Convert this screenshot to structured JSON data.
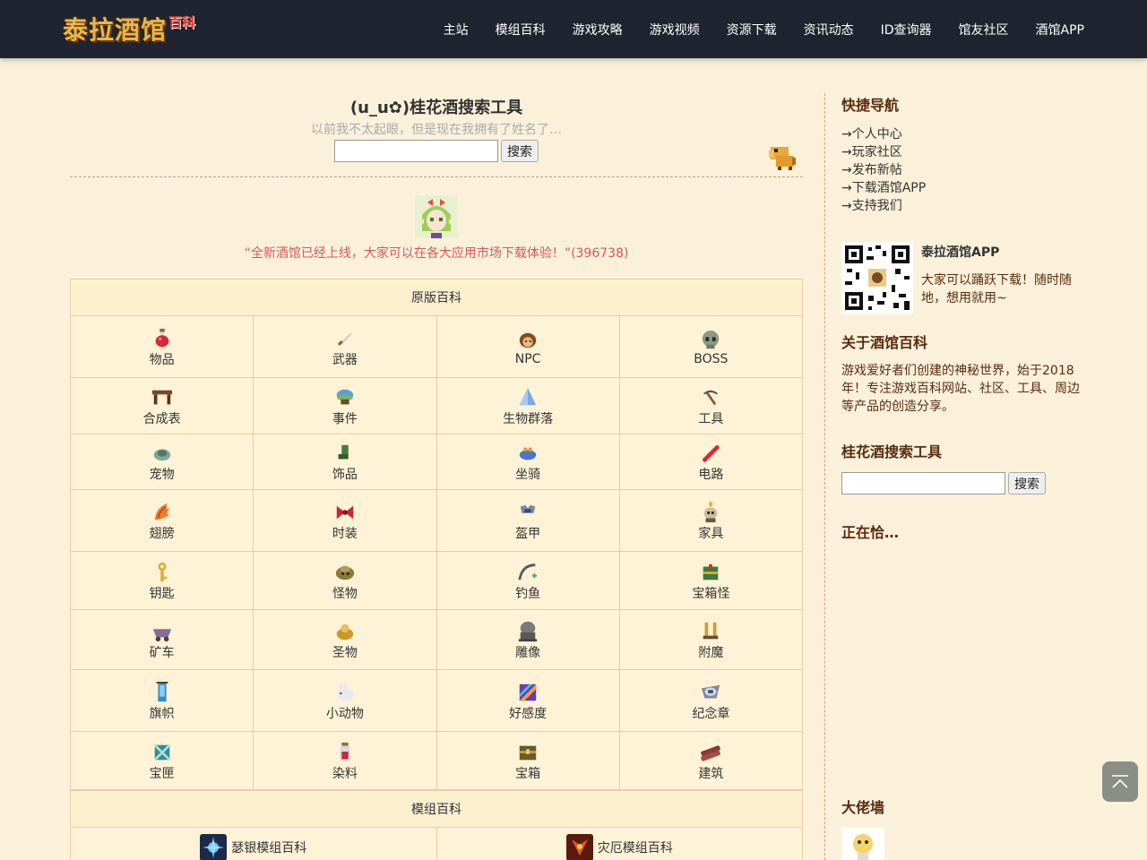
{
  "header": {
    "logo_text": "泰拉酒馆",
    "logo_badge": "百科",
    "nav": [
      "主站",
      "模组百科",
      "游戏攻略",
      "游戏视频",
      "资源下载",
      "资讯动态",
      "ID查询器",
      "馆友社区",
      "酒馆APP"
    ]
  },
  "search_tool": {
    "title": "(u_u✿)桂花酒搜索工具",
    "subtitle": "以前我不太起眼，但是现在我拥有了姓名了…",
    "input_placeholder": "",
    "button": "搜索"
  },
  "announcement": {
    "text": "“全新酒馆已经上线，大家可以在各大应用市场下载体验！”(396738)"
  },
  "vanilla_wiki": {
    "heading": "原版百科",
    "categories": [
      {
        "label": "物品",
        "icon": "potion-icon"
      },
      {
        "label": "武器",
        "icon": "sword-icon"
      },
      {
        "label": "NPC",
        "icon": "npc-head-icon"
      },
      {
        "label": "BOSS",
        "icon": "skull-icon"
      },
      {
        "label": "合成表",
        "icon": "workbench-icon"
      },
      {
        "label": "事件",
        "icon": "event-icon"
      },
      {
        "label": "生物群落",
        "icon": "crystal-icon"
      },
      {
        "label": "工具",
        "icon": "pickaxe-icon"
      },
      {
        "label": "宠物",
        "icon": "pet-icon"
      },
      {
        "label": "饰品",
        "icon": "boots-icon"
      },
      {
        "label": "坐骑",
        "icon": "mount-icon"
      },
      {
        "label": "电路",
        "icon": "wire-icon"
      },
      {
        "label": "翅膀",
        "icon": "wings-icon"
      },
      {
        "label": "时装",
        "icon": "bow-icon"
      },
      {
        "label": "盔甲",
        "icon": "armor-icon"
      },
      {
        "label": "家具",
        "icon": "candle-skull-icon"
      },
      {
        "label": "钥匙",
        "icon": "key-icon"
      },
      {
        "label": "怪物",
        "icon": "monster-icon"
      },
      {
        "label": "钓鱼",
        "icon": "fishing-icon"
      },
      {
        "label": "宝箱怪",
        "icon": "mimic-icon"
      },
      {
        "label": "矿车",
        "icon": "minecart-icon"
      },
      {
        "label": "圣物",
        "icon": "relic-icon"
      },
      {
        "label": "雕像",
        "icon": "statue-icon"
      },
      {
        "label": "附魔",
        "icon": "enchant-icon"
      },
      {
        "label": "旗帜",
        "icon": "banner-icon"
      },
      {
        "label": "小动物",
        "icon": "bunny-icon"
      },
      {
        "label": "好感度",
        "icon": "rainbow-icon"
      },
      {
        "label": "纪念章",
        "icon": "medal-icon"
      },
      {
        "label": "宝匣",
        "icon": "box-icon"
      },
      {
        "label": "染料",
        "icon": "dye-icon"
      },
      {
        "label": "宝箱",
        "icon": "chest-icon"
      },
      {
        "label": "建筑",
        "icon": "wood-icon"
      }
    ]
  },
  "mod_wiki": {
    "heading": "模组百科",
    "mods": [
      {
        "label": "瑟银模组百科",
        "icon": "thorium-icon"
      },
      {
        "label": "灾厄模组百科",
        "icon": "calamity-icon"
      }
    ]
  },
  "sidebar": {
    "quick_nav_title": "快捷导航",
    "quick_links": [
      "→个人中心",
      "→玩家社区",
      "→发布新帖",
      "→下载酒馆APP",
      "→支持我们"
    ],
    "app_name": "泰拉酒馆APP",
    "app_desc": "大家可以踊跃下载！随时随地，想用就用~",
    "about_title": "关于酒馆百科",
    "about_text": "游戏爱好者们创建的神秘世界，始于2018年！专注游戏百科网站、社区、工具、周边等产品的创造分享。",
    "search_title": "桂花酒搜索工具",
    "search_button": "搜索",
    "online_title": "正在恰…",
    "wall_title": "大佬墙"
  },
  "colors": {
    "header_bg": "#1f2430",
    "page_bg": "#fbf1db",
    "announce_text": "#d2585e",
    "sidebar_heading": "#5a2b10"
  }
}
